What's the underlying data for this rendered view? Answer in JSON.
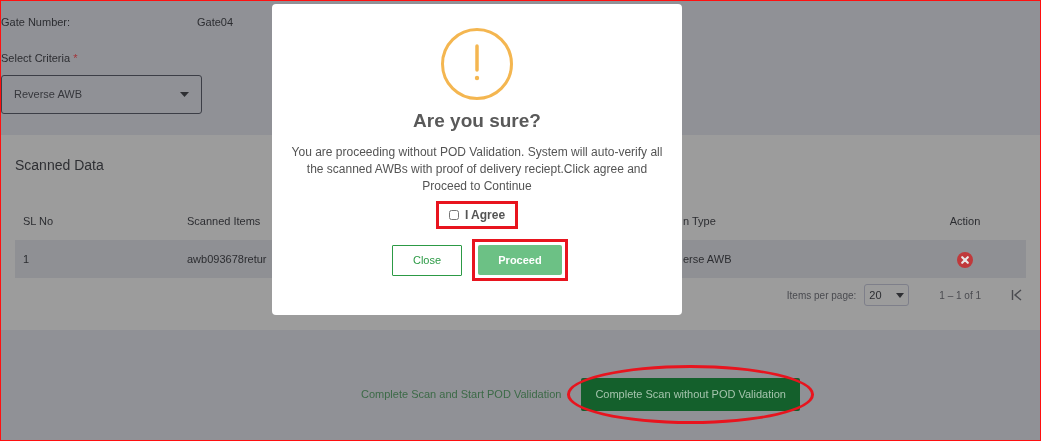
{
  "annotation_frame": true,
  "gate": {
    "label": "Gate Number:",
    "value": "Gate04"
  },
  "criteria": {
    "label": "Select Criteria",
    "required_mark": "*",
    "value": "Reverse AWB"
  },
  "scanned": {
    "title": "Scanned Data",
    "columns": [
      {
        "label": "SL No"
      },
      {
        "label": "Scanned Items"
      },
      {
        "label": "n Type"
      },
      {
        "label": "Action"
      }
    ],
    "rows": [
      {
        "cells": [
          "1",
          "awb093678retur",
          "erse AWB"
        ]
      }
    ],
    "paginator": {
      "label": "Items per page:",
      "value": "20",
      "range": "1 – 1 of 1"
    }
  },
  "footer_actions": [
    {
      "label": "Complete Scan and Start POD Validation",
      "kind": "link",
      "highlighted": false
    },
    {
      "label": "Complete Scan without POD Validation",
      "kind": "button",
      "highlighted": true
    }
  ],
  "dialog": {
    "title": "Are you sure?",
    "message": "You are proceeding without POD Validation. System will auto-verify all the scanned AWBs with proof of delivery reciept.Click agree and Proceed to Continue",
    "agree": {
      "label": "I Agree",
      "checked": false,
      "highlighted": true
    },
    "buttons": [
      {
        "label": "Close",
        "kind": "outline",
        "highlighted": false
      },
      {
        "label": "Proceed",
        "kind": "primary",
        "highlighted": true
      }
    ]
  }
}
